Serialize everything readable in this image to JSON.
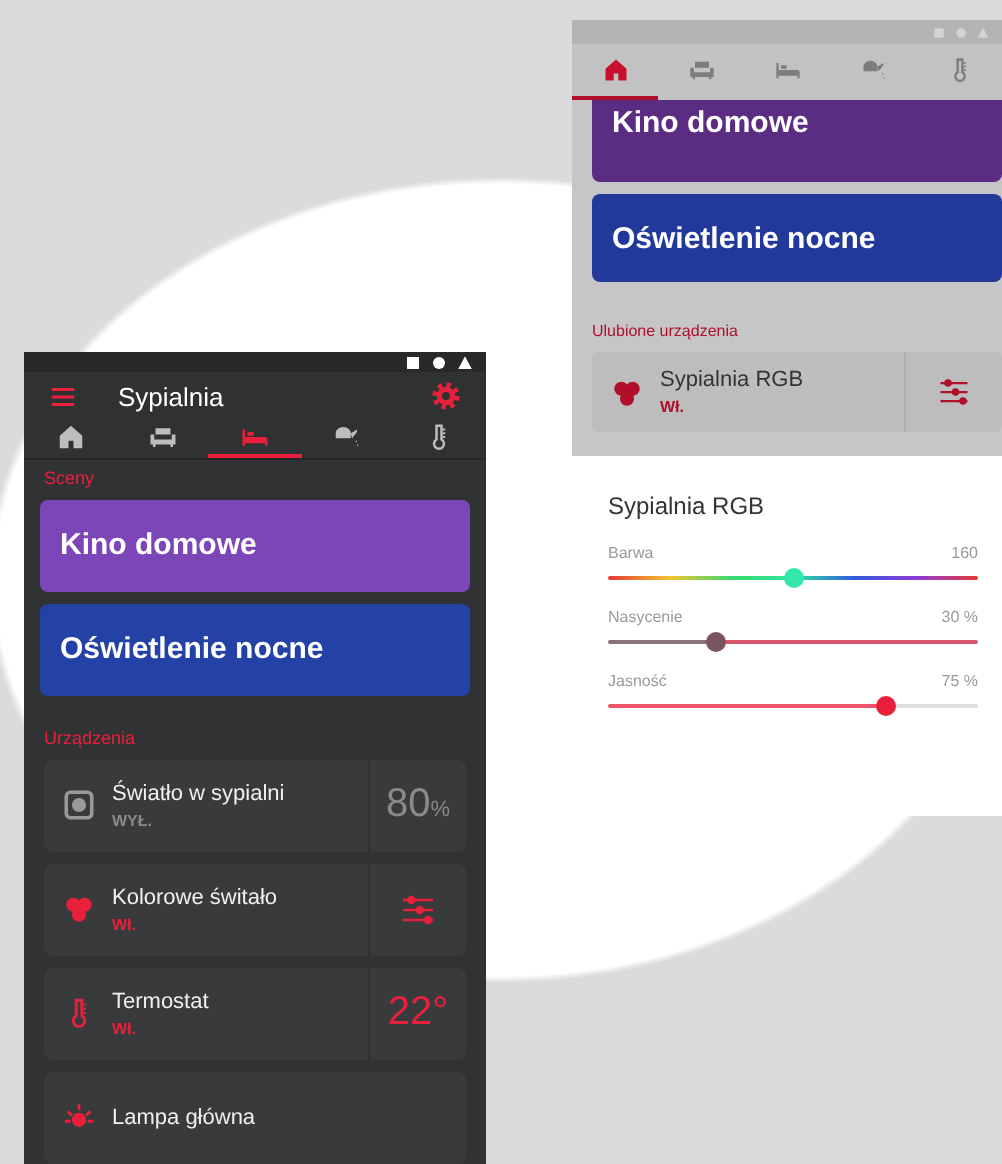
{
  "left_screen": {
    "title": "Sypialnia",
    "tabs": [
      {
        "kind": "home",
        "selected": false
      },
      {
        "kind": "sofa",
        "selected": false
      },
      {
        "kind": "bed",
        "selected": true
      },
      {
        "kind": "watering-can",
        "selected": false
      },
      {
        "kind": "thermometer",
        "selected": false
      }
    ],
    "scenes_label": "Sceny",
    "scenes": [
      {
        "name": "Kino domowe",
        "color": "#7c45b8"
      },
      {
        "name": "Oświetlenie nocne",
        "color": "#2442a6"
      }
    ],
    "devices_label": "Urządzenia",
    "devices": [
      {
        "name": "Światło w sypialni",
        "state": "WYŁ.",
        "on": false,
        "kind": "dimmer",
        "value": "80",
        "unit": "%"
      },
      {
        "name": "Kolorowe świtało",
        "state": "Wł.",
        "on": true,
        "kind": "rgb"
      },
      {
        "name": "Termostat",
        "state": "Wł.",
        "on": true,
        "kind": "thermostat",
        "value": "22°"
      },
      {
        "name": "Lampa główna",
        "on": true,
        "kind": "lamp"
      }
    ]
  },
  "right_screen": {
    "tabs": [
      {
        "kind": "home",
        "selected": true
      },
      {
        "kind": "sofa",
        "selected": false
      },
      {
        "kind": "bed",
        "selected": false
      },
      {
        "kind": "watering-can",
        "selected": false
      },
      {
        "kind": "thermometer",
        "selected": false
      }
    ],
    "scenes": [
      {
        "name": "Kino domowe",
        "color": "#5a2c82"
      },
      {
        "name": "Oświetlenie nocne",
        "color": "#22399a"
      }
    ],
    "favorites_label": "Ulubione urządzenia",
    "favorites": [
      {
        "name": "Sypialnia RGB",
        "state": "Wł.",
        "on": true,
        "kind": "rgb"
      }
    ],
    "sheet": {
      "title": "Sypialnia RGB",
      "sliders": [
        {
          "label": "Barwa",
          "reading": "160",
          "level": 0.5,
          "kind": "hue"
        },
        {
          "label": "Nasycenie",
          "reading": "30 %",
          "level": 0.29,
          "kind": "saturation"
        },
        {
          "label": "Jasność",
          "reading": "75 %",
          "level": 0.75,
          "kind": "brightness"
        }
      ]
    }
  }
}
